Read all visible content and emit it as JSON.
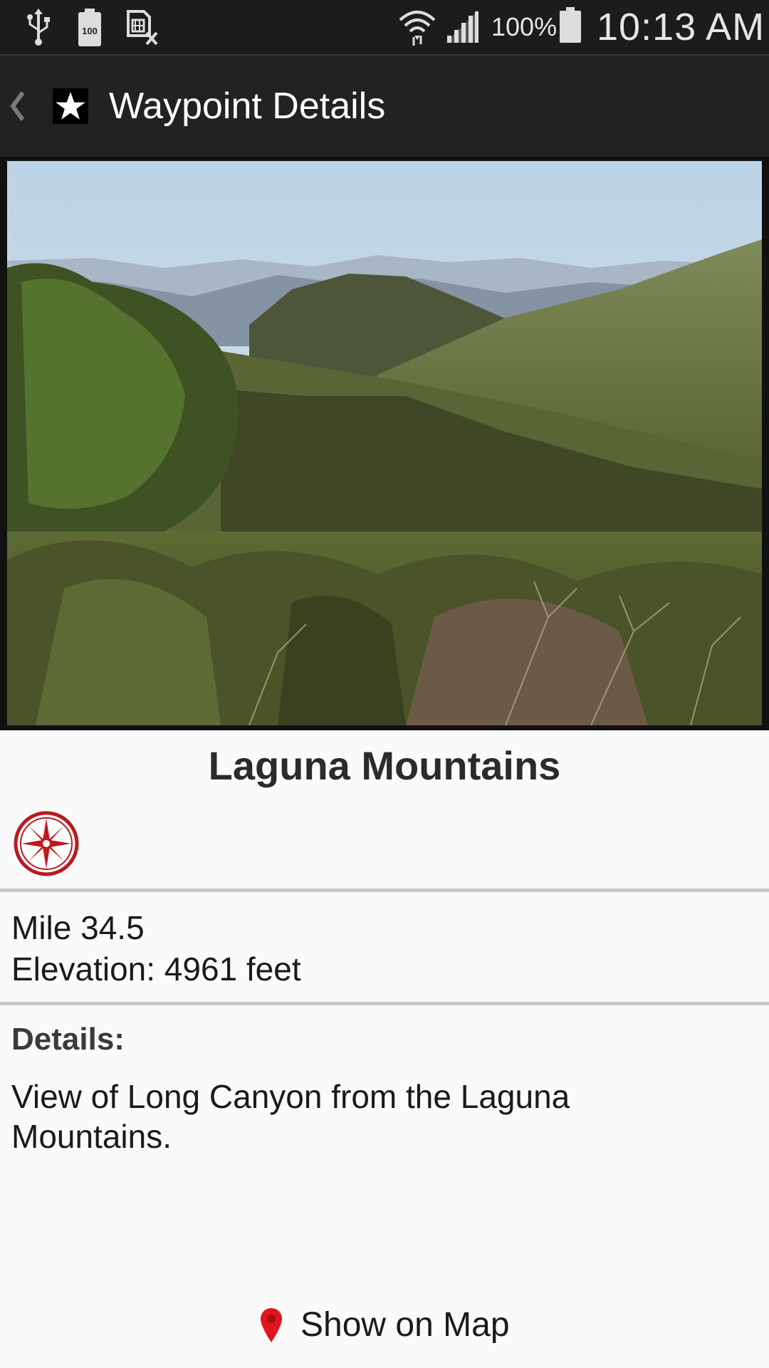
{
  "status_bar": {
    "icons": [
      "usb-icon",
      "battery-100-notification-icon",
      "sim-card-x-icon",
      "wifi-icon",
      "cell-signal-icon",
      "battery-icon"
    ],
    "battery_percent": "100%",
    "time": "10:13 AM"
  },
  "action_bar": {
    "title": "Waypoint Details",
    "back_icon": "chevron-left-icon",
    "app_icon": "star-icon"
  },
  "waypoint": {
    "name": "Laguna Mountains",
    "category_icon": "compass-rose-icon",
    "mile": "Mile 34.5",
    "elevation": "Elevation: 4961 feet",
    "details_label": "Details:",
    "details_text": "View of Long Canyon from the Laguna Mountains."
  },
  "footer": {
    "show_on_map_label": "Show on Map",
    "pin_icon": "map-pin-icon"
  },
  "colors": {
    "status_bar_bg": "#1c1c1c",
    "action_bar_bg": "#222222",
    "content_bg": "#fafafa",
    "accent_red": "#c4161c",
    "divider": "#c9c9c9"
  }
}
